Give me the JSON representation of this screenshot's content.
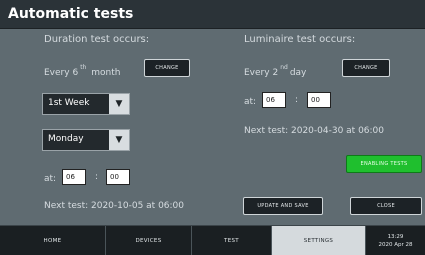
{
  "window": {
    "title": "Automatic tests"
  },
  "duration": {
    "header": "Duration test occurs:",
    "every_prefix": "Every",
    "every_value": "6",
    "every_suffix": "th",
    "every_unit": "month",
    "change_label": "CHANGE",
    "week_value": "1st Week",
    "day_value": "Monday",
    "at_label": "at:",
    "hour": "06",
    "minute": "00",
    "colon": ":",
    "next_test": "Next test:   2020-10-05   at   06:00"
  },
  "luminaire": {
    "header": "Luminaire test occurs:",
    "every_prefix": "Every",
    "every_value": "2",
    "every_suffix": "nd",
    "every_unit": "day",
    "change_label": "CHANGE",
    "at_label": "at:",
    "hour": "06",
    "minute": "00",
    "colon": ":",
    "next_test": "Next test:   2020-04-30   at   06:00"
  },
  "actions": {
    "enabling_tests": "ENABLING TESTS",
    "update_save": "UPDATE AND SAVE",
    "close": "CLOSE"
  },
  "nav": {
    "tabs": [
      "HOME",
      "DEVICES",
      "TEST",
      "SETTINGS"
    ],
    "active": "SETTINGS",
    "clock_time": "13:29",
    "clock_date": "2020 Apr 28"
  },
  "colors": {
    "background": "#5f6b71",
    "titlebar": "#2b3338",
    "accent_green": "#1fbf2e",
    "nav_bar": "#1a1f22"
  }
}
